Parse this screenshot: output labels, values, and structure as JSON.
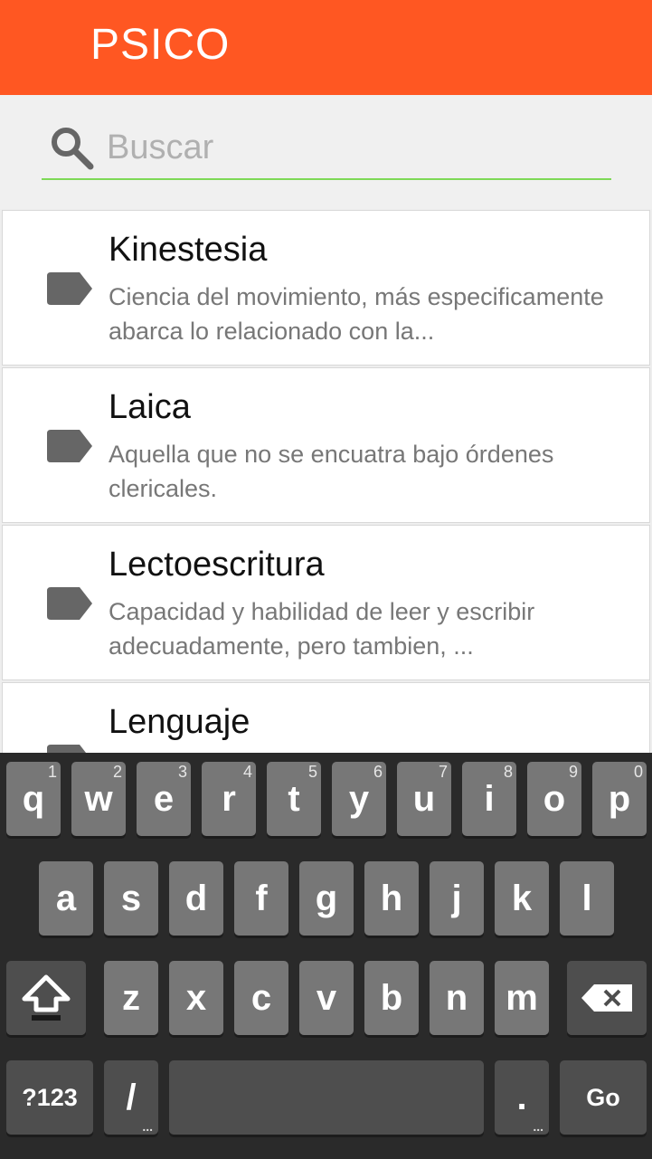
{
  "app": {
    "title": "PSICO"
  },
  "search": {
    "placeholder": "Buscar",
    "value": ""
  },
  "entries": [
    {
      "term": "Kinestesia",
      "description": "Ciencia del movimiento, más especificamente abarca lo relacionado con la..."
    },
    {
      "term": "Laica",
      "description": "Aquella que no se encuatra bajo órdenes clericales."
    },
    {
      "term": "Lectoescritura",
      "description": "Capacidad y habilidad de leer y escribir adecuadamente, pero tambien, ..."
    },
    {
      "term": "Lenguaje",
      "description": ""
    }
  ],
  "keyboard": {
    "row1": [
      {
        "key": "q",
        "hint": "1"
      },
      {
        "key": "w",
        "hint": "2"
      },
      {
        "key": "e",
        "hint": "3"
      },
      {
        "key": "r",
        "hint": "4"
      },
      {
        "key": "t",
        "hint": "5"
      },
      {
        "key": "y",
        "hint": "6"
      },
      {
        "key": "u",
        "hint": "7"
      },
      {
        "key": "i",
        "hint": "8"
      },
      {
        "key": "o",
        "hint": "9"
      },
      {
        "key": "p",
        "hint": "0"
      }
    ],
    "row2": [
      "a",
      "s",
      "d",
      "f",
      "g",
      "h",
      "j",
      "k",
      "l"
    ],
    "row3": [
      "z",
      "x",
      "c",
      "v",
      "b",
      "n",
      "m"
    ],
    "symbols_label": "?123",
    "slash_label": "/",
    "slash_sub": "...",
    "period_label": ".",
    "period_sub": "...",
    "go_label": "Go",
    "shift_icon": "shift-arrow-icon",
    "backspace_icon": "backspace-icon"
  },
  "colors": {
    "appbar": "#ff5722",
    "accent_line": "#7ed957",
    "keyboard_bg": "#2a2a2a",
    "key": "#777777"
  }
}
